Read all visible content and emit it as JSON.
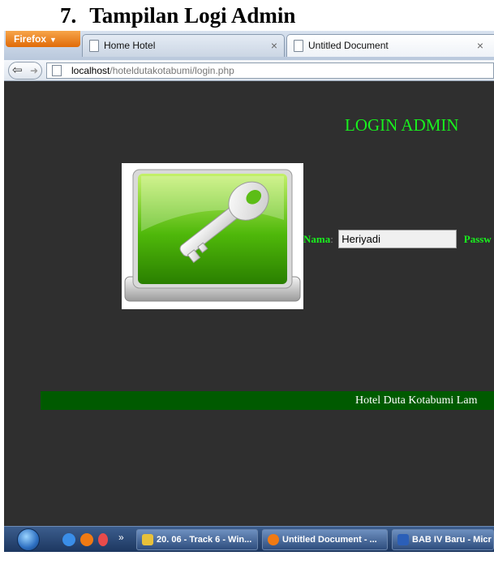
{
  "document": {
    "section_number": "7.",
    "section_title": "Tampilan Logi Admin"
  },
  "browser": {
    "menu_button": "Firefox",
    "tabs": [
      {
        "title": "Home Hotel",
        "close": "×"
      },
      {
        "title": "Untitled Document",
        "close": "×"
      }
    ],
    "url_host": "localhost",
    "url_path": "/hoteldutakotabumi/login.php"
  },
  "page": {
    "title": "LOGIN ADMIN",
    "nama_label": "Nama",
    "nama_value": "Heriyadi",
    "password_label": "Passw",
    "footer_text": "Hotel Duta Kotabumi Lam"
  },
  "taskbar": {
    "overflow": "»",
    "buttons": [
      {
        "label": "20. 06 - Track 6 - Win..."
      },
      {
        "label": "Untitled Document - ..."
      },
      {
        "label": "BAB IV Baru - Micr"
      }
    ]
  },
  "colors": {
    "page_background": "#2f2f2f",
    "accent_green": "#19f01e",
    "footer_green": "#005a00",
    "firefox_orange": "#e06b08"
  },
  "icons": [
    "firefox-logo-icon",
    "page-icon",
    "back-arrow-icon",
    "forward-arrow-icon",
    "key-icon",
    "windows-start-icon",
    "internet-explorer-icon",
    "firefox-icon",
    "winamp-icon",
    "word-icon"
  ]
}
